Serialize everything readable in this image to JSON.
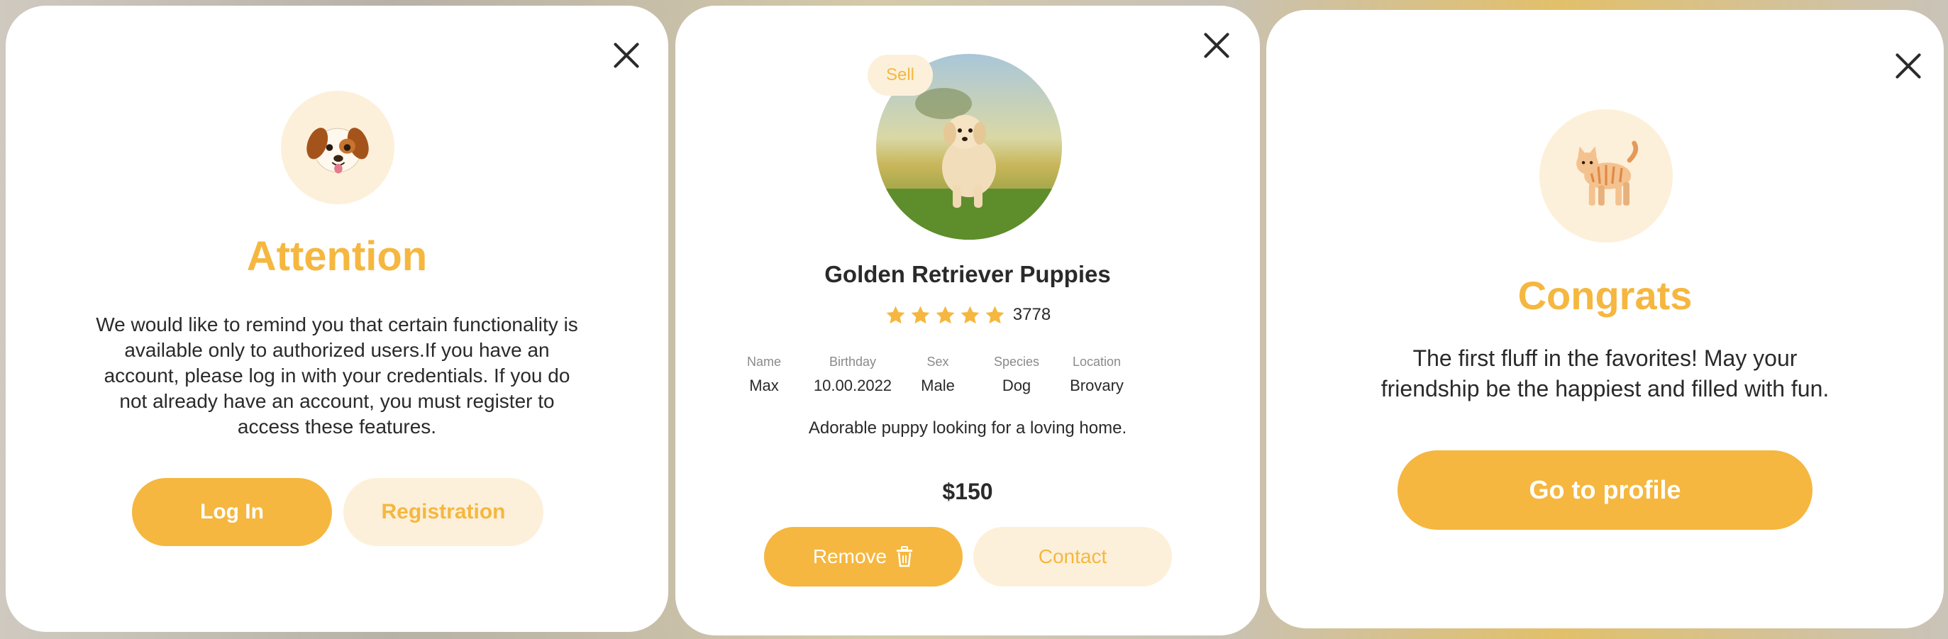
{
  "attention_modal": {
    "icon": "dog-face-icon",
    "title": "Attention",
    "message_lines": [
      "We would like to remind you that certain functionality is",
      "available only to authorized users.If you have an",
      "account, please log in with your credentials. If you do",
      "not already have an account, you must register to",
      "access these features."
    ],
    "login_label": "Log In",
    "registration_label": "Registration"
  },
  "pet_modal": {
    "badge": "Sell",
    "title": "Golden Retriever Puppies",
    "rating": 5,
    "rating_count": "3778",
    "details": [
      {
        "label": "Name",
        "value": "Max"
      },
      {
        "label": "Birthday",
        "value": "10.00.2022"
      },
      {
        "label": "Sex",
        "value": "Male"
      },
      {
        "label": "Species",
        "value": "Dog"
      },
      {
        "label": "Location",
        "value": "Brovary"
      }
    ],
    "description": "Adorable puppy looking for a loving home.",
    "price": "$150",
    "remove_label": "Remove",
    "contact_label": "Contact"
  },
  "congrats_modal": {
    "icon": "cat-icon",
    "title": "Congrats",
    "message_lines": [
      "The first fluff in the favorites! May your",
      "friendship be the happiest and filled with fun."
    ],
    "profile_label": "Go to profile"
  },
  "colors": {
    "accent": "#f5b73f",
    "accent_light": "#fdf0da",
    "text": "#2a2a2a",
    "muted": "#8a8a8a"
  }
}
